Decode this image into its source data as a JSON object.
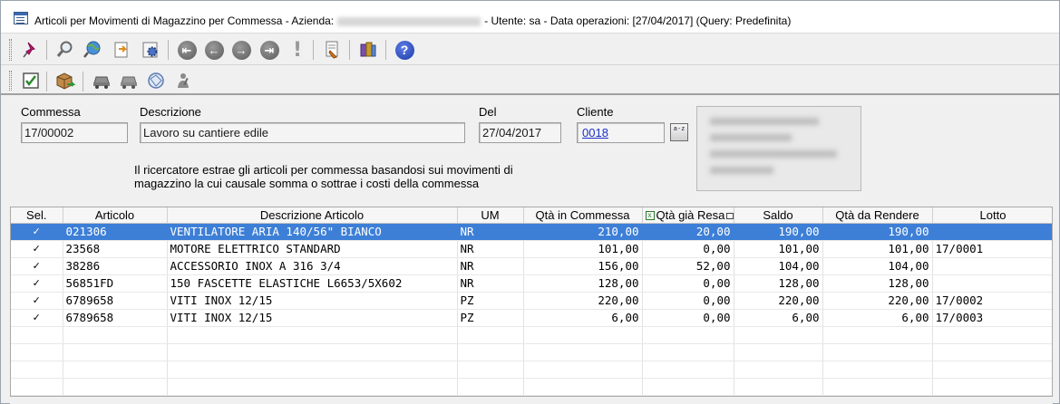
{
  "window": {
    "title": "Articoli per Movimenti di Magazzino per Commessa - Azienda:",
    "title_suffix": "- Utente: sa - Data operazioni: [27/04/2017] (Query: Predefinita)"
  },
  "toolbar1": {
    "icons": [
      "pin-icon",
      "search-icon",
      "globe-search-icon",
      "export-icon",
      "settings-icon",
      "first-record-icon",
      "previous-record-icon",
      "next-record-icon",
      "last-record-icon",
      "alert-icon",
      "report-icon",
      "modules-icon",
      "help-icon"
    ],
    "help_label": "?",
    "alert_label": "!"
  },
  "toolbar2": {
    "icons": [
      "checkbox-icon",
      "warehouse-move-icon",
      "car-icon",
      "car-disabled-icon",
      "route-icon",
      "worker-icon"
    ]
  },
  "form": {
    "commessa_label": "Commessa",
    "commessa_value": "17/00002",
    "descrizione_label": "Descrizione",
    "descrizione_value": "Lavoro su cantiere edile",
    "del_label": "Del",
    "del_value": "27/04/2017",
    "cliente_label": "Cliente",
    "cliente_value": "0018",
    "lookup_label": "a-z",
    "info_text": "Il ricercatore estrae gli articoli per commessa basandosi sui movimenti di magazzino la cui causale somma o sottrae i costi della commessa"
  },
  "grid": {
    "columns": [
      "Sel.",
      "Articolo",
      "Descrizione Articolo",
      "UM",
      "Qtà in Commessa",
      "Qtà già Resa",
      "Saldo",
      "Qtà da Rendere",
      "Lotto"
    ],
    "rows": [
      {
        "sel": "✓",
        "articolo": "021306",
        "descrizione": "VENTILATORE ARIA 140/56\" BIANCO",
        "um": "NR",
        "qta_commessa": "210,00",
        "qta_resa": "20,00",
        "saldo": "190,00",
        "qta_rendere": "190,00",
        "lotto": ""
      },
      {
        "sel": "✓",
        "articolo": "23568",
        "descrizione": "MOTORE ELETTRICO STANDARD",
        "um": "NR",
        "qta_commessa": "101,00",
        "qta_resa": "0,00",
        "saldo": "101,00",
        "qta_rendere": "101,00",
        "lotto": "17/0001"
      },
      {
        "sel": "✓",
        "articolo": "38286",
        "descrizione": "ACCESSORIO INOX A 316 3/4",
        "um": "NR",
        "qta_commessa": "156,00",
        "qta_resa": "52,00",
        "saldo": "104,00",
        "qta_rendere": "104,00",
        "lotto": ""
      },
      {
        "sel": "✓",
        "articolo": "56851FD",
        "descrizione": "150 FASCETTE ELASTICHE L6653/5X602",
        "um": "NR",
        "qta_commessa": "128,00",
        "qta_resa": "0,00",
        "saldo": "128,00",
        "qta_rendere": "128,00",
        "lotto": ""
      },
      {
        "sel": "✓",
        "articolo": "6789658",
        "descrizione": "VITI INOX 12/15",
        "um": "PZ",
        "qta_commessa": "220,00",
        "qta_resa": "0,00",
        "saldo": "220,00",
        "qta_rendere": "220,00",
        "lotto": "17/0002"
      },
      {
        "sel": "✓",
        "articolo": "6789658",
        "descrizione": "VITI INOX 12/15",
        "um": "PZ",
        "qta_commessa": "6,00",
        "qta_resa": "0,00",
        "saldo": "6,00",
        "qta_rendere": "6,00",
        "lotto": "17/0003"
      }
    ]
  },
  "colors": {
    "selected_row": "#3d7fd6",
    "link": "#1a2fc9"
  }
}
